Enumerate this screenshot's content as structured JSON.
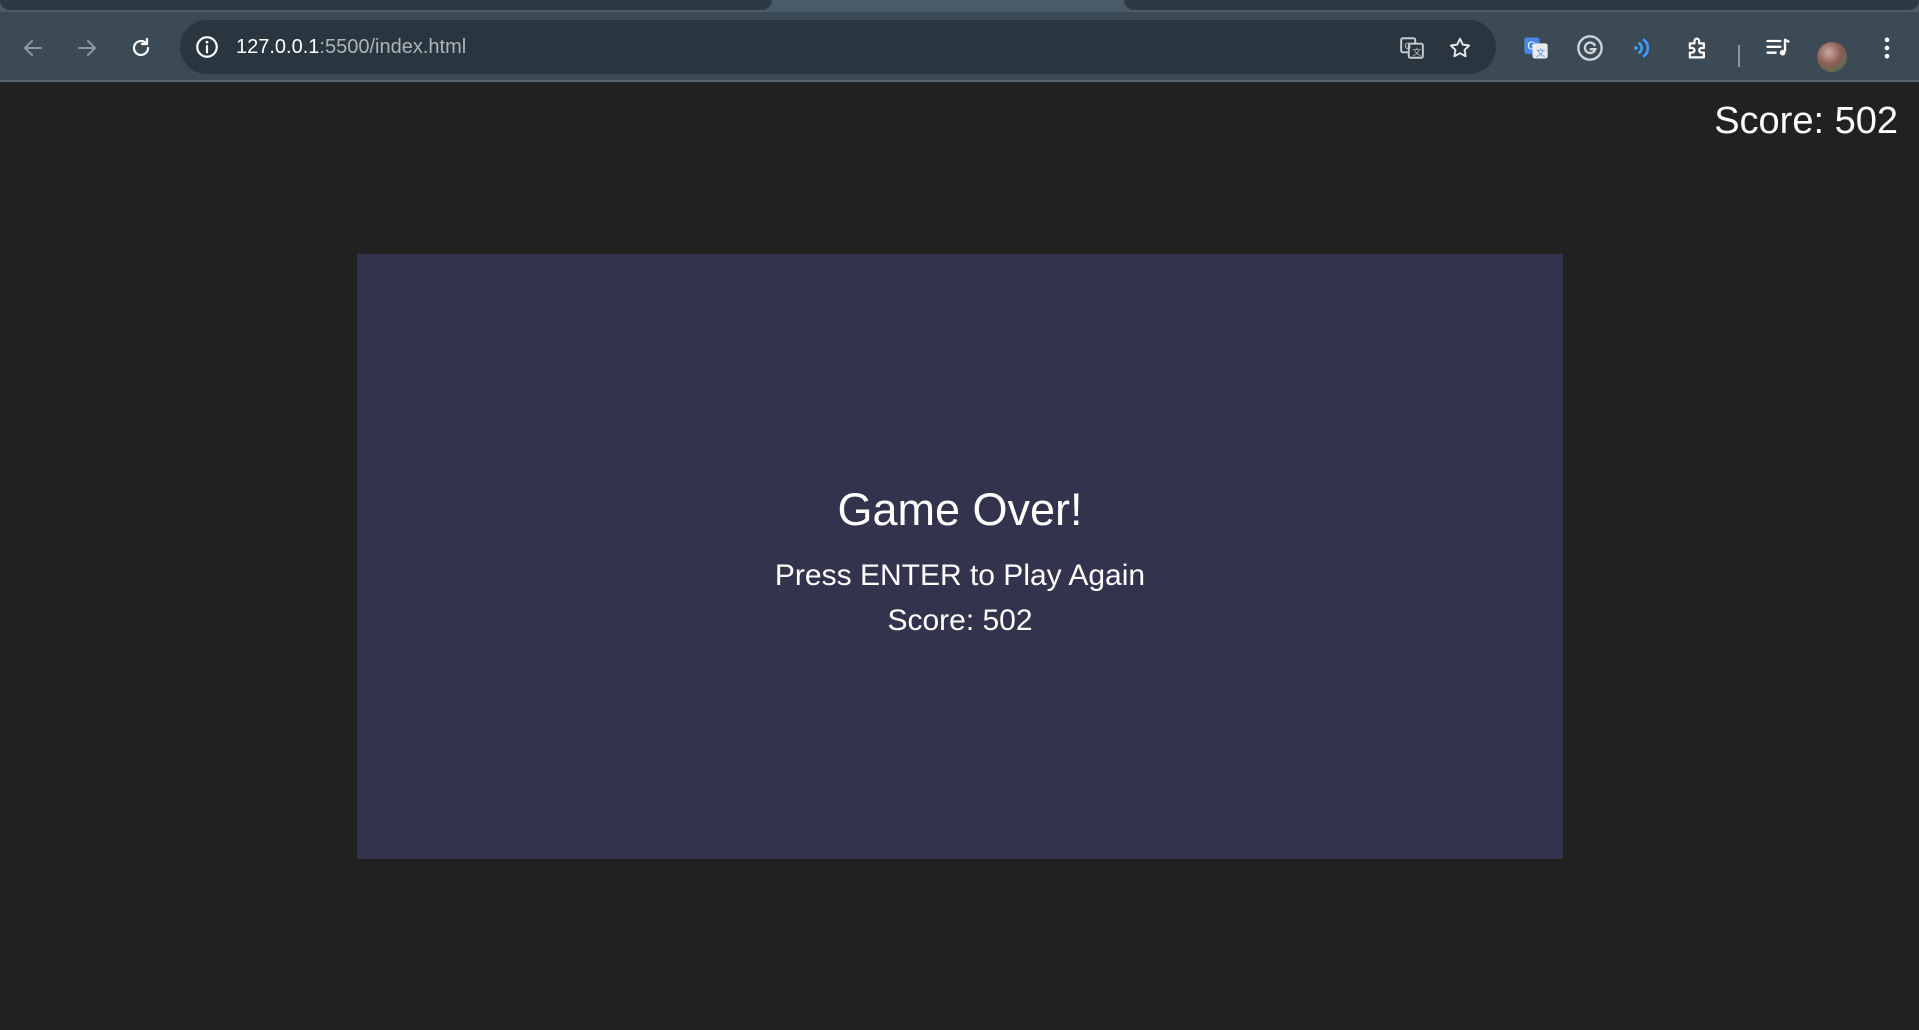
{
  "browser": {
    "url_host": "127.0.0.1",
    "url_path": ":5500/index.html",
    "icons": {
      "back": "arrow-left-icon",
      "forward": "arrow-right-icon",
      "reload": "reload-icon",
      "site_info": "info-icon",
      "translate": "translate-icon",
      "bookmark": "star-icon",
      "google_translate_ext": "google-translate-icon",
      "grammarly_ext": "grammarly-icon",
      "read_aloud_ext": "read-aloud-icon",
      "extensions": "puzzle-icon",
      "media": "media-control-icon",
      "menu": "kebab-menu-icon"
    }
  },
  "game": {
    "hud_score": "Score: 502",
    "overlay": {
      "title": "Game Over!",
      "prompt": "Press ENTER to Play Again",
      "score": "Score: 502"
    }
  },
  "colors": {
    "page_background": "#212121",
    "panel_background": "#34334d",
    "toolbar_background": "#3b4a54",
    "text": "#ffffff"
  }
}
